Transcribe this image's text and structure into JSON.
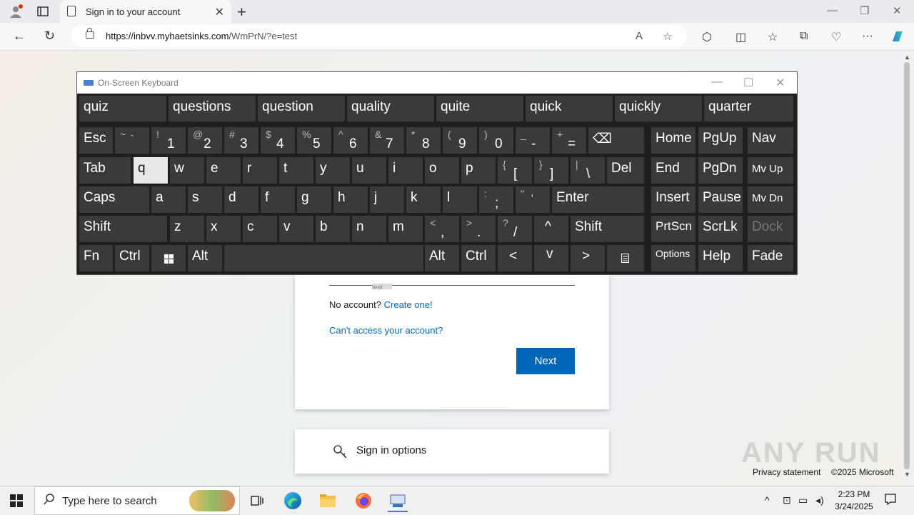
{
  "browser": {
    "tab_title": "Sign in to your account",
    "url_domain": "https://inbvv.myhaetsinks.com",
    "url_path": "/WmPrN/?e=test"
  },
  "osk": {
    "title": "On-Screen Keyboard",
    "suggestions": [
      "quiz",
      "questions",
      "question",
      "quality",
      "quite",
      "quick",
      "quickly",
      "quarter"
    ],
    "keys": {
      "esc": "Esc",
      "k1": "1",
      "s1": "!",
      "k2": "2",
      "s2": "@",
      "k3": "3",
      "s3": "#",
      "k4": "4",
      "s4": "$",
      "k5": "5",
      "s5": "%",
      "k6": "6",
      "s6": "^",
      "k7": "7",
      "s7": "&",
      "k8": "8",
      "s8": "*",
      "k9": "9",
      "s9": "(",
      "k0": "0",
      "s0": ")",
      "minus": "-",
      "sminus": "_",
      "eq": "=",
      "seq": "+",
      "tilde_s": "~",
      "tilde": "`",
      "bksp": "⌫",
      "home": "Home",
      "pgup": "PgUp",
      "nav": "Nav",
      "tab": "Tab",
      "q": "q",
      "w": "w",
      "e": "e",
      "r": "r",
      "t": "t",
      "y": "y",
      "u": "u",
      "i": "i",
      "o": "o",
      "p": "p",
      "lb": "[",
      "slb": "{",
      "rb": "]",
      "srb": "}",
      "bs": "\\",
      "sbs": "|",
      "del": "Del",
      "end": "End",
      "pgdn": "PgDn",
      "mvup": "Mv Up",
      "caps": "Caps",
      "a": "a",
      "s": "s",
      "d": "d",
      "f": "f",
      "g": "g",
      "h": "h",
      "j": "j",
      "k": "k",
      "l": "l",
      "semi": ";",
      "ssemi": ":",
      "quote": "'",
      "squote": "\"",
      "enter": "Enter",
      "insert": "Insert",
      "pause": "Pause",
      "mvdn": "Mv Dn",
      "shift": "Shift",
      "z": "z",
      "x": "x",
      "c": "c",
      "v": "v",
      "b": "b",
      "n": "n",
      "m": "m",
      "comma": ",",
      "scomma": "<",
      "period": ".",
      "speriod": ">",
      "slash": "/",
      "sslash": "?",
      "up": "^",
      "rshift": "Shift",
      "prtscn": "PrtScn",
      "scrlk": "ScrLk",
      "dock": "Dock",
      "fn": "Fn",
      "ctrl": "Ctrl",
      "alt": "Alt",
      "ralt": "Alt",
      "rctrl": "Ctrl",
      "left": "<",
      "down": "v",
      "right": ">",
      "options": "Options",
      "help": "Help",
      "fade": "Fade"
    }
  },
  "signin": {
    "typed_hint": "test",
    "no_account": "No account?",
    "create": "Create one!",
    "cant_access": "Can't access your account?",
    "next": "Next",
    "sign_in_options": "Sign in options"
  },
  "footer": {
    "privacy": "Privacy statement",
    "copyright": "©2025 Microsoft"
  },
  "watermark": "ANY RUN",
  "taskbar": {
    "search_placeholder": "Type here to search",
    "time": "2:23 PM",
    "date": "3/24/2025"
  }
}
